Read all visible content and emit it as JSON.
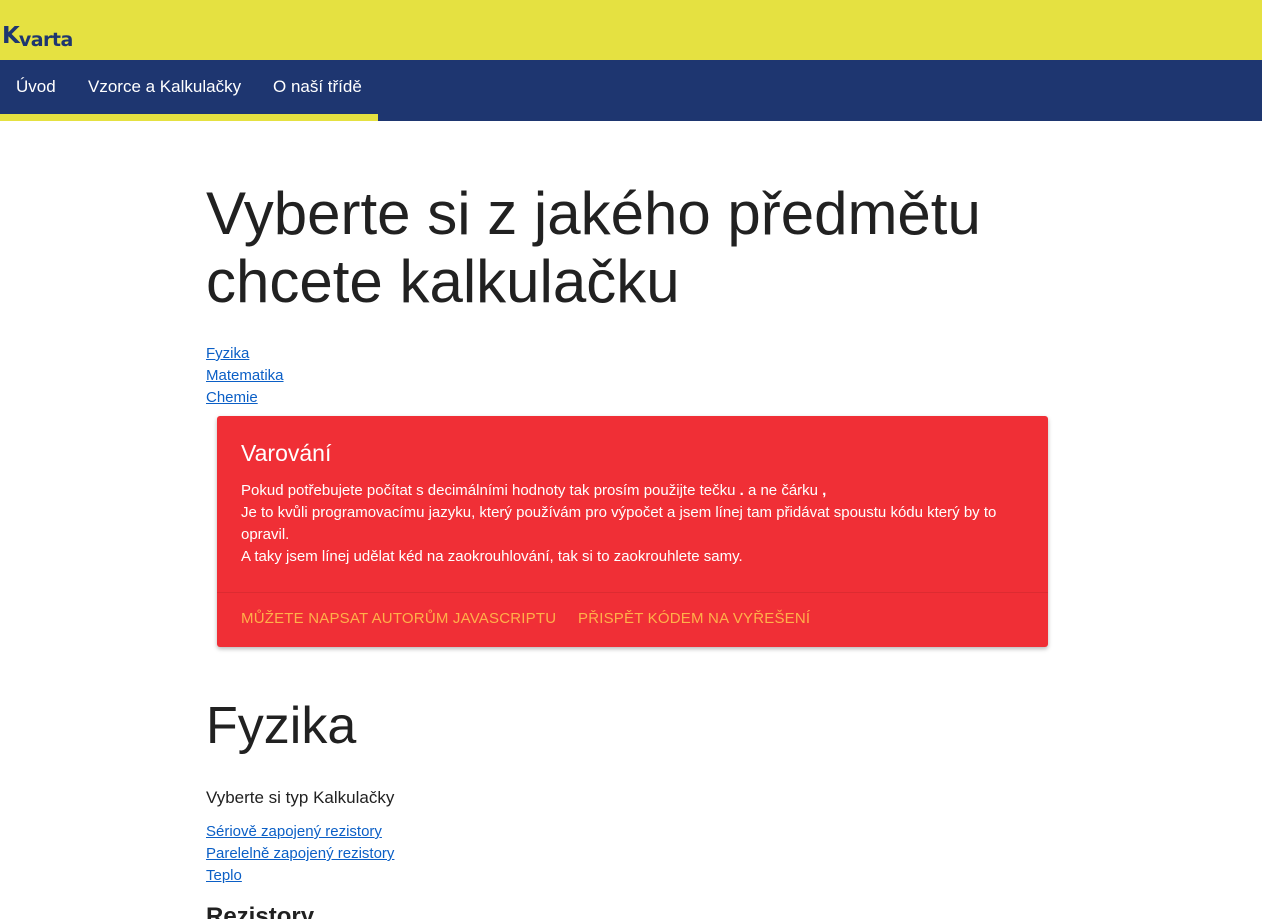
{
  "header": {
    "logo_k": "K",
    "logo_rest": "varta"
  },
  "nav": {
    "items": [
      "Úvod",
      "Vzorce a Kalkulačky",
      "O naší třídě"
    ]
  },
  "main": {
    "headline_line1": "Vyberte si z jakého předmětu",
    "headline_line2": "chcete kalkulačku",
    "subject_links": [
      "Fyzika",
      "Matematika",
      "Chemie"
    ]
  },
  "warning": {
    "title": "Varování",
    "line1_pre": "Pokud potřebujete počítat s decimálními hodnoty tak prosím použijte tečku",
    "line1_dot": ".",
    "line1_mid": "a ne čárku",
    "line1_comma": ",",
    "line2": "Je to kvůli programovacímu jazyku, který používám pro výpočet a jsem línej tam přidávat spoustu kódu který by to opravil.",
    "line3": "A taky jsem línej udělat kéd na zaokrouhlování, tak si to zaokrouhlete samy.",
    "action_write": "Můžete napsat autorům javascriptu",
    "action_contribute": "Přispět kódem na vyřešení"
  },
  "physics": {
    "title": "Fyzika",
    "subtitle": "Vyberte si typ Kalkulačky",
    "links": [
      "Sériově zapojený rezistory",
      "Parelelně zapojený rezistory",
      "Teplo"
    ],
    "next_heading": "Rezistory"
  },
  "colors": {
    "topbar": "#e5e141",
    "navbar": "#1e3670",
    "warning_bg": "#f02f36",
    "warning_action": "#ffb04a",
    "link": "#0b5fc6"
  }
}
